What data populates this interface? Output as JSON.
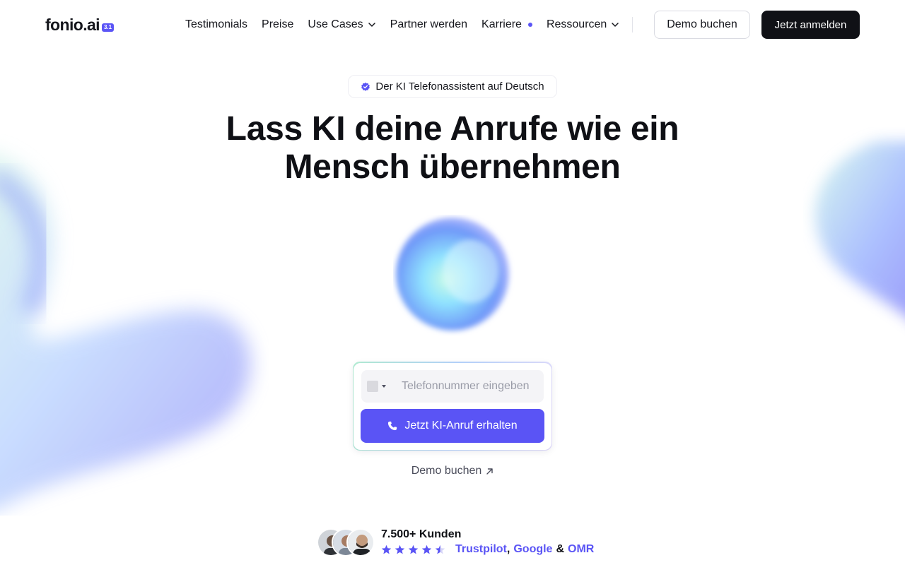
{
  "header": {
    "logo": {
      "text": "fonio",
      "suffix": ".ai",
      "badge": "3.1"
    },
    "nav": [
      {
        "label": "Testimonials"
      },
      {
        "label": "Preise"
      },
      {
        "label": "Use Cases",
        "dropdown": true
      },
      {
        "label": "Partner werden"
      },
      {
        "label": "Karriere",
        "dot": true
      },
      {
        "label": "Ressourcen",
        "dropdown": true
      }
    ],
    "demo_button": "Demo buchen",
    "signup_button": "Jetzt anmelden"
  },
  "hero": {
    "pill": "Der KI Telefonassistent auf Deutsch",
    "headline_line1": "Lass KI deine Anrufe wie ein",
    "headline_line2": "Mensch übernehmen"
  },
  "call_card": {
    "phone_placeholder": "Telefonnummer eingeben",
    "phone_value": "",
    "call_button": "Jetzt KI-Anruf erhalten"
  },
  "demo_link": "Demo buchen",
  "social_proof": {
    "customers": "7.500+ Kunden",
    "rating_stars": 4.5,
    "sources": [
      "Trustpilot",
      "Google",
      "OMR"
    ],
    "separator_comma": ",",
    "separator_and": "&"
  },
  "colors": {
    "accent": "#5a54f5",
    "dark": "#101116",
    "text": "#15161c"
  },
  "icons": {
    "pill": "verified-badge-icon",
    "call": "phone-icon",
    "demo_link": "arrow-up-right-icon",
    "dropdown": "chevron-down-icon",
    "rating": "star-icon"
  }
}
